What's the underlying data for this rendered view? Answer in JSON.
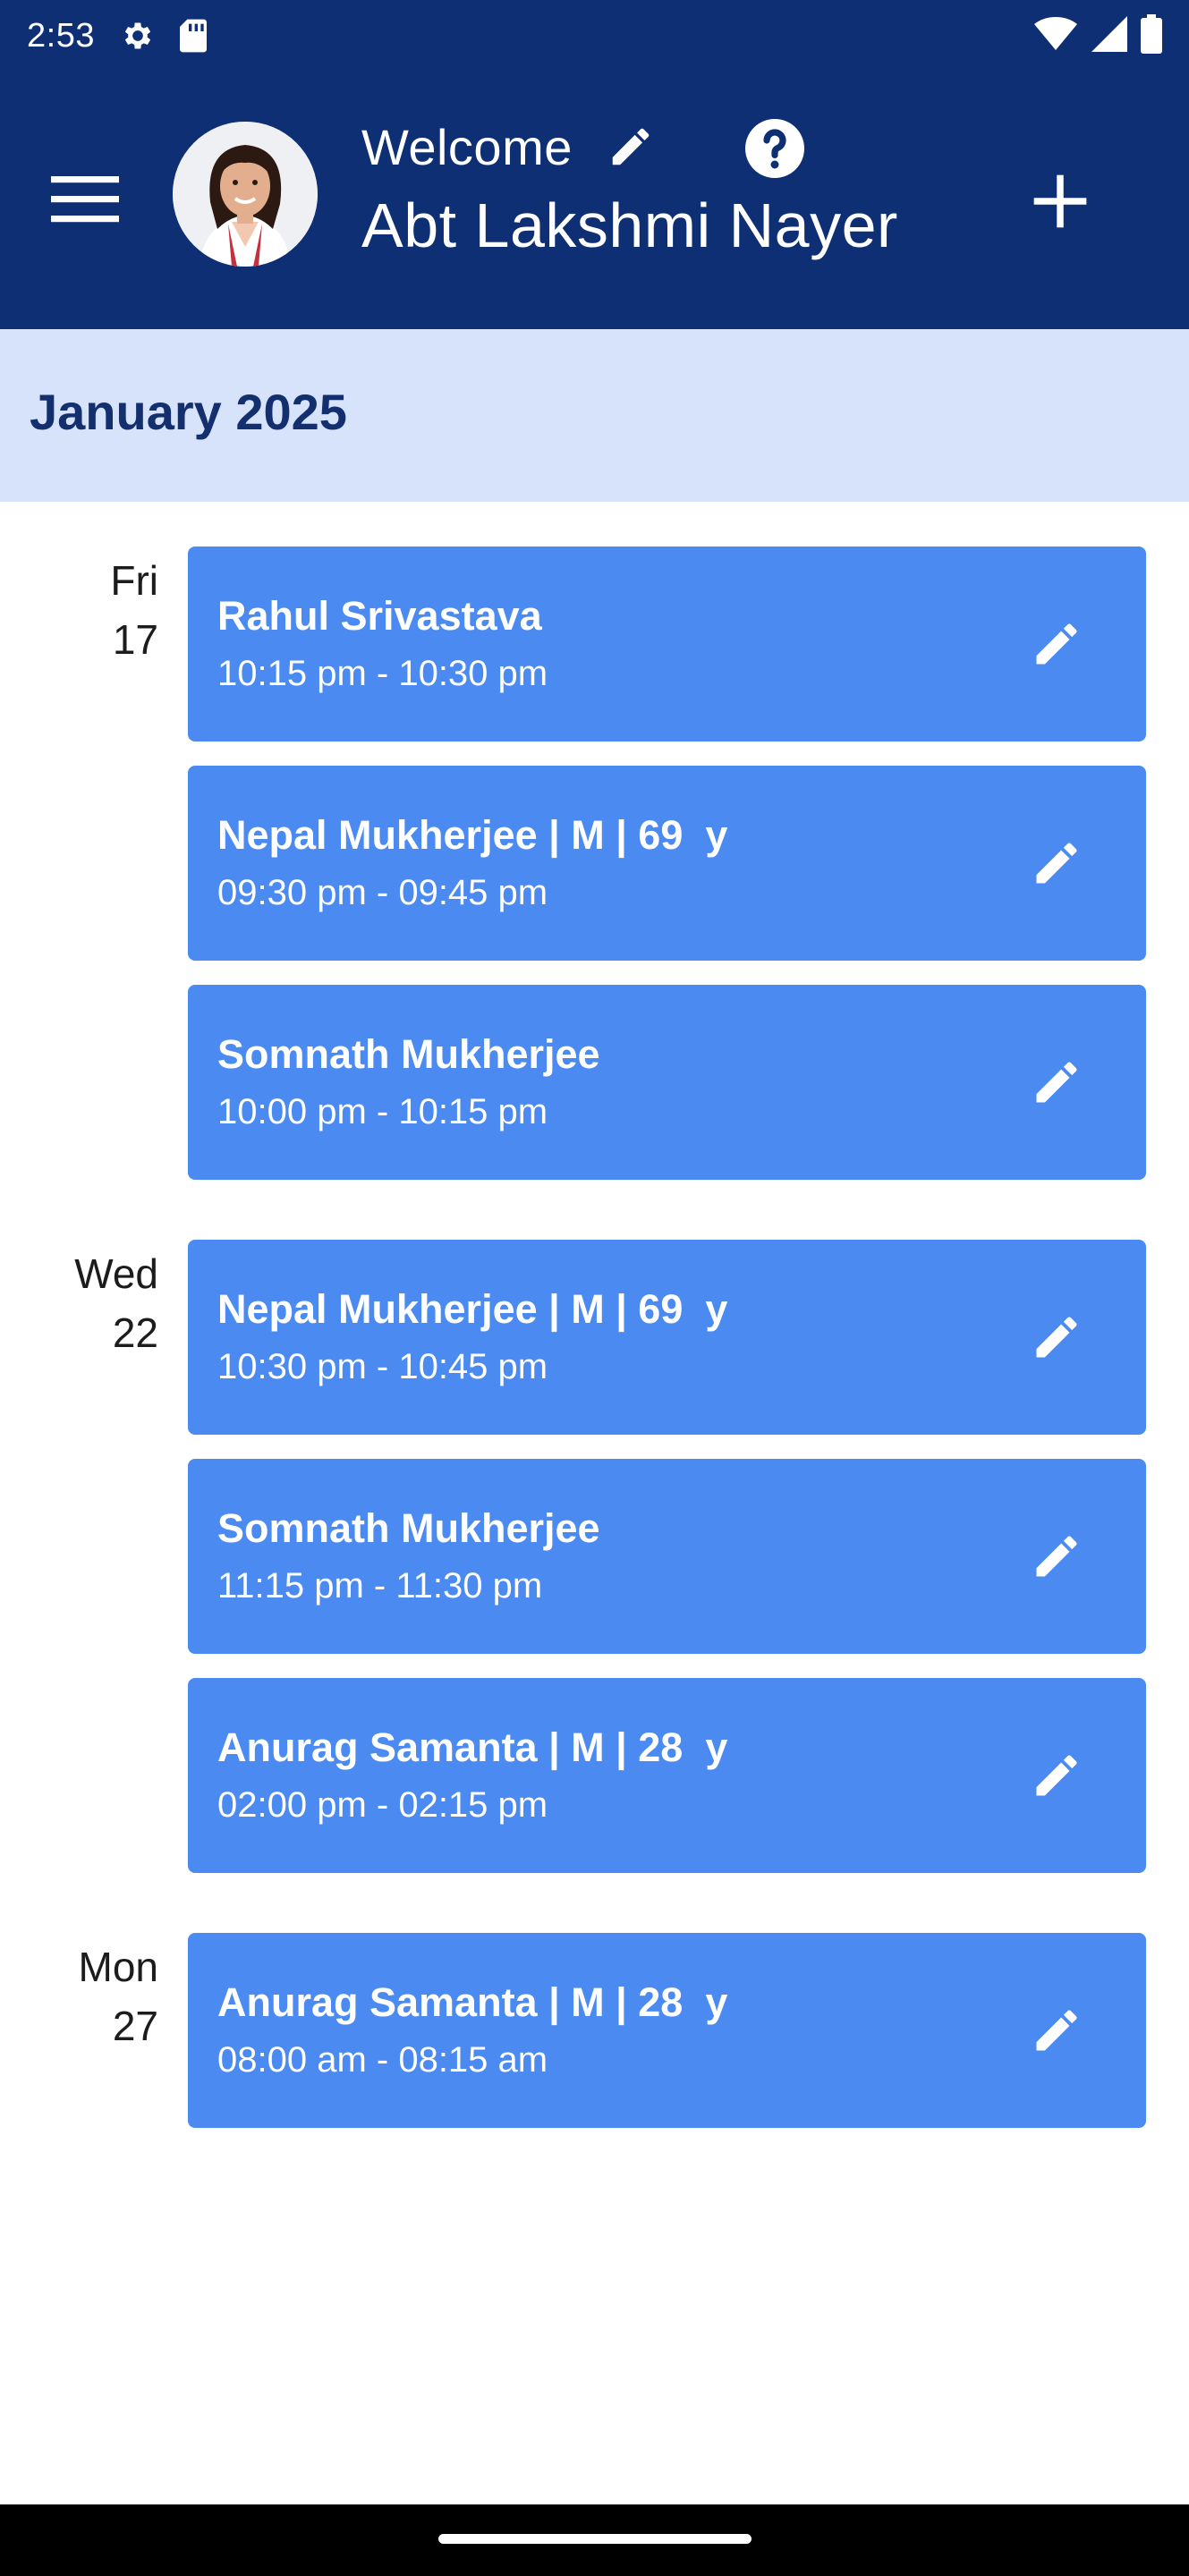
{
  "status_bar": {
    "time": "2:53",
    "left_icons": [
      "gear-icon",
      "sd-card-icon"
    ],
    "right_icons": [
      "wifi-icon",
      "signal-icon",
      "battery-icon"
    ]
  },
  "header": {
    "welcome": "Welcome",
    "user_name": "Abt Lakshmi Nayer",
    "background_color": "#0f2f74"
  },
  "calendar": {
    "month": "January 2025",
    "card_color": "#4a8af1",
    "days": [
      {
        "weekday": "Fri",
        "date": "17",
        "appointments": [
          {
            "title": "Rahul Srivastava",
            "time": "10:15 pm - 10:30 pm"
          },
          {
            "title": "Nepal Mukherjee | M | 69  y",
            "time": "09:30 pm - 09:45 pm"
          },
          {
            "title": "Somnath Mukherjee",
            "time": "10:00 pm - 10:15 pm"
          }
        ]
      },
      {
        "weekday": "Wed",
        "date": "22",
        "appointments": [
          {
            "title": "Nepal Mukherjee | M | 69  y",
            "time": "10:30 pm - 10:45 pm"
          },
          {
            "title": "Somnath Mukherjee",
            "time": "11:15 pm - 11:30 pm"
          },
          {
            "title": "Anurag Samanta | M | 28  y",
            "time": "02:00 pm - 02:15 pm"
          }
        ]
      },
      {
        "weekday": "Mon",
        "date": "27",
        "appointments": [
          {
            "title": "Anurag Samanta | M | 28  y",
            "time": "08:00 am - 08:15 am"
          }
        ]
      }
    ]
  }
}
